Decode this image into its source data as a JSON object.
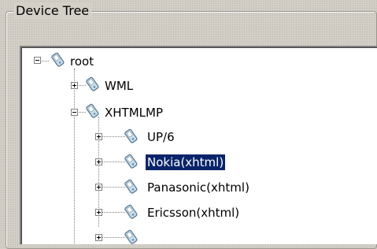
{
  "panel": {
    "title": "Device Tree"
  },
  "tree": {
    "selected": "Nokia(xhtml)",
    "nodes": [
      {
        "label": "root",
        "state": "expanded",
        "icon": "device-icon"
      },
      {
        "label": "WML",
        "state": "collapsed",
        "icon": "device-icon"
      },
      {
        "label": "XHTMLMP",
        "state": "expanded",
        "icon": "device-icon"
      },
      {
        "label": "UP/6",
        "state": "collapsed",
        "icon": "device-icon"
      },
      {
        "label": "Nokia(xhtml)",
        "state": "collapsed",
        "icon": "device-icon"
      },
      {
        "label": "Panasonic(xhtml)",
        "state": "collapsed",
        "icon": "device-icon"
      },
      {
        "label": "Ericsson(xhtml)",
        "state": "collapsed",
        "icon": "device-icon"
      }
    ]
  },
  "colors": {
    "window_bg": "#d4d0c8",
    "tree_bg": "#ffffff",
    "selection_bg": "#0a246a",
    "selection_fg": "#ffffff",
    "icon_body": "#c4dceb",
    "icon_outline": "#56738a"
  }
}
